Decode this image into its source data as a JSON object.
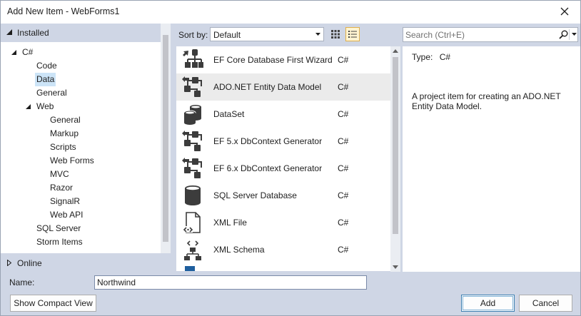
{
  "window": {
    "title": "Add New Item - WebForms1",
    "close_label": "✕"
  },
  "tree": {
    "installed_label": "Installed",
    "online_label": "Online",
    "items": [
      {
        "label": "C#",
        "has_arrow": true,
        "expanded": true
      },
      {
        "label": "Code"
      },
      {
        "label": "Data",
        "selected": true
      },
      {
        "label": "General"
      },
      {
        "label": "Web",
        "has_arrow": true,
        "expanded": true
      },
      {
        "label": "General"
      },
      {
        "label": "Markup"
      },
      {
        "label": "Scripts"
      },
      {
        "label": "Web Forms"
      },
      {
        "label": "MVC"
      },
      {
        "label": "Razor"
      },
      {
        "label": "SignalR"
      },
      {
        "label": "Web API"
      },
      {
        "label": "SQL Server"
      },
      {
        "label": "Storm Items"
      }
    ]
  },
  "toolbar": {
    "sort_label": "Sort by:",
    "sort_value": "Default",
    "grid_view_icon": "grid-view-icon",
    "list_view_icon": "list-view-icon"
  },
  "search": {
    "placeholder": "Search (Ctrl+E)",
    "icon": "search-icon"
  },
  "items": [
    {
      "name": "EF Core Database First Wizard",
      "lang": "C#",
      "icon": "ef-wizard-icon"
    },
    {
      "name": "ADO.NET Entity Data Model",
      "lang": "C#",
      "icon": "entity-model-icon",
      "selected": true
    },
    {
      "name": "DataSet",
      "lang": "C#",
      "icon": "dataset-icon"
    },
    {
      "name": "EF 5.x DbContext Generator",
      "lang": "C#",
      "icon": "entity-model-icon"
    },
    {
      "name": "EF 6.x DbContext Generator",
      "lang": "C#",
      "icon": "entity-model-icon"
    },
    {
      "name": "SQL Server Database",
      "lang": "C#",
      "icon": "database-icon"
    },
    {
      "name": "XML File",
      "lang": "C#",
      "icon": "xml-file-icon"
    },
    {
      "name": "XML Schema",
      "lang": "C#",
      "icon": "xml-schema-icon"
    }
  ],
  "details": {
    "type_label": "Type:",
    "type_value": "C#",
    "description": "A project item for creating an ADO.NET Entity Data Model."
  },
  "bottom": {
    "name_label": "Name:",
    "name_value": "Northwind",
    "compact_view_label": "Show Compact View",
    "add_label": "Add",
    "cancel_label": "Cancel"
  },
  "colors": {
    "chrome": "#cfd6e5",
    "selection": "#cce4f7",
    "icon": "#3c3c3c",
    "accent_border": "#3c7fb1"
  }
}
